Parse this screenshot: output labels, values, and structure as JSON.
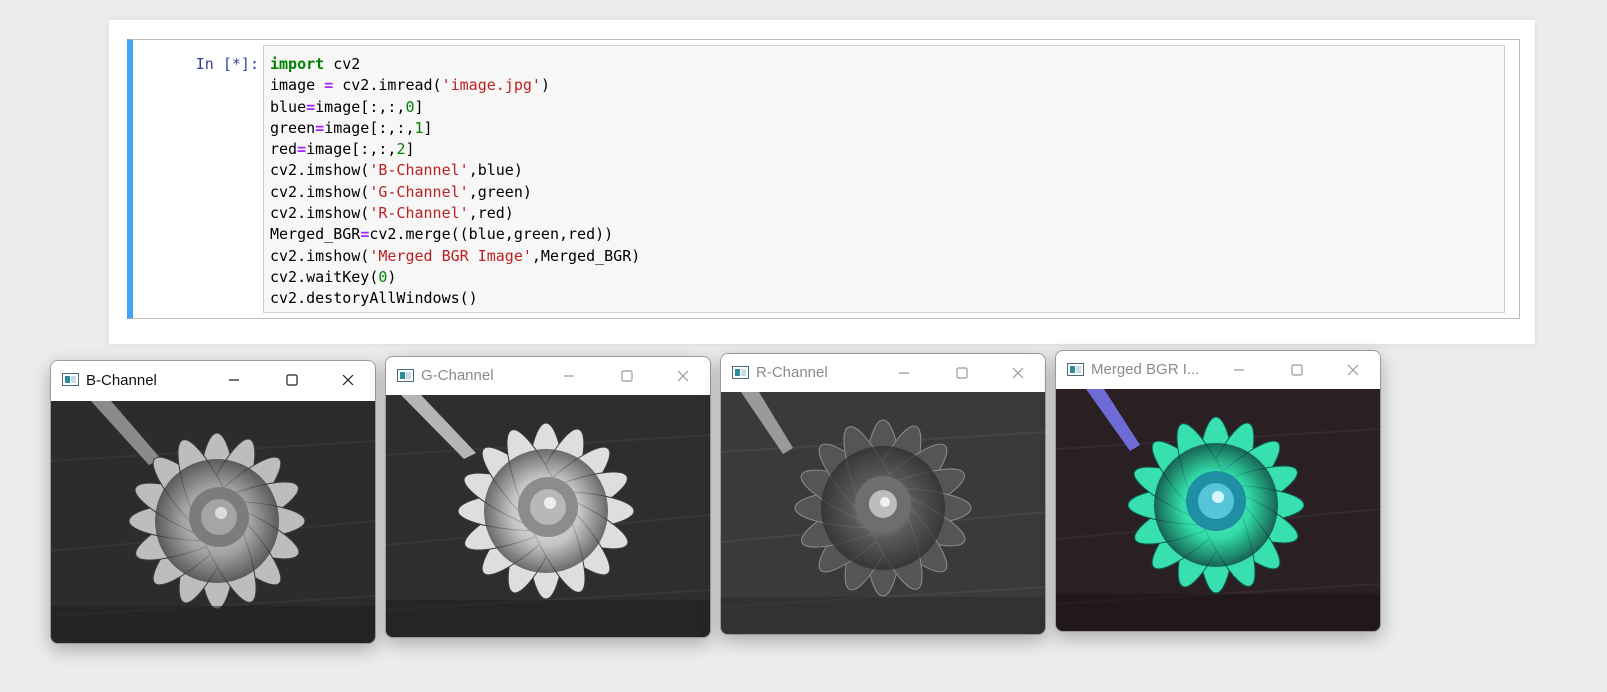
{
  "notebook": {
    "prompt": "In [*]:",
    "code_lines": [
      [
        {
          "t": "import",
          "c": "kw"
        },
        {
          "t": " cv2"
        }
      ],
      [
        {
          "t": "image "
        },
        {
          "t": "=",
          "c": "op"
        },
        {
          "t": " cv2.imread("
        },
        {
          "t": "'image.jpg'",
          "c": "str"
        },
        {
          "t": ")"
        }
      ],
      [
        {
          "t": "blue"
        },
        {
          "t": "=",
          "c": "op"
        },
        {
          "t": "image[:,:,"
        },
        {
          "t": "0",
          "c": "num"
        },
        {
          "t": "]"
        }
      ],
      [
        {
          "t": "green"
        },
        {
          "t": "=",
          "c": "op"
        },
        {
          "t": "image[:,:,"
        },
        {
          "t": "1",
          "c": "num"
        },
        {
          "t": "]"
        }
      ],
      [
        {
          "t": "red"
        },
        {
          "t": "=",
          "c": "op"
        },
        {
          "t": "image[:,:,"
        },
        {
          "t": "2",
          "c": "num"
        },
        {
          "t": "]"
        }
      ],
      [
        {
          "t": "cv2.imshow("
        },
        {
          "t": "'B-Channel'",
          "c": "str"
        },
        {
          "t": ",blue)"
        }
      ],
      [
        {
          "t": "cv2.imshow("
        },
        {
          "t": "'G-Channel'",
          "c": "str"
        },
        {
          "t": ",green)"
        }
      ],
      [
        {
          "t": "cv2.imshow("
        },
        {
          "t": "'R-Channel'",
          "c": "str"
        },
        {
          "t": ",red)"
        }
      ],
      [
        {
          "t": "Merged_BGR"
        },
        {
          "t": "=",
          "c": "op"
        },
        {
          "t": "cv2.merge((blue,green,red))"
        }
      ],
      [
        {
          "t": "cv2.imshow("
        },
        {
          "t": "'Merged BGR Image'",
          "c": "str"
        },
        {
          "t": ",Merged_BGR)"
        }
      ],
      [
        {
          "t": "cv2.waitKey("
        },
        {
          "t": "0",
          "c": "num"
        },
        {
          "t": ")"
        }
      ],
      [
        {
          "t": "cv2.destoryAllWindows()"
        }
      ]
    ]
  },
  "windows": [
    {
      "title": "B-Channel",
      "active": true
    },
    {
      "title": "G-Channel",
      "active": false
    },
    {
      "title": "R-Channel",
      "active": false
    },
    {
      "title": "Merged BGR I...",
      "active": false
    }
  ],
  "colors": {
    "cell_accent": "#42a5f5",
    "prompt": "#303f9f",
    "keyword": "#008000",
    "operator": "#aa22ff",
    "string": "#ba2121",
    "number": "#008000"
  },
  "icons": {
    "window_app": "opencv-window-icon",
    "minimize": "minimize-icon",
    "maximize": "maximize-icon",
    "close": "close-icon"
  }
}
